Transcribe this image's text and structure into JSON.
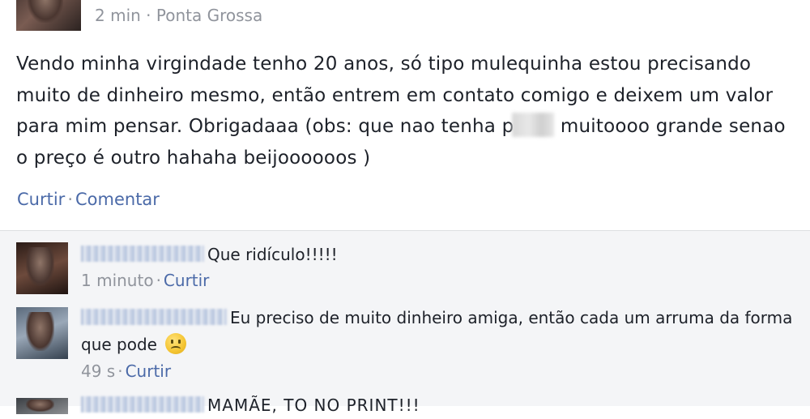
{
  "post": {
    "time": "2 min",
    "location": "Ponta Grossa",
    "text_before_blur": "Vendo minha virgindade tenho 20 anos, só tipo mulequinha estou precisando muito de dinheiro mesmo, então entrem em contato comigo e deixem um valor para mim pensar. Obrigadaaa (obs: que nao tenha p",
    "text_after_blur": "muitoooo grande senao o preço é outro hahaha beijoooooos )",
    "like_label": "Curtir",
    "comment_label": "Comentar"
  },
  "comments": [
    {
      "text": "Que ridículo!!!!!",
      "time": "1 minuto",
      "like_label": "Curtir"
    },
    {
      "text": "Eu preciso de muito dinheiro amiga, então cada um arruma da forma que pode",
      "time": "49 s",
      "like_label": "Curtir"
    },
    {
      "text": "MAMÃE, TO NO PRINT!!!"
    }
  ]
}
